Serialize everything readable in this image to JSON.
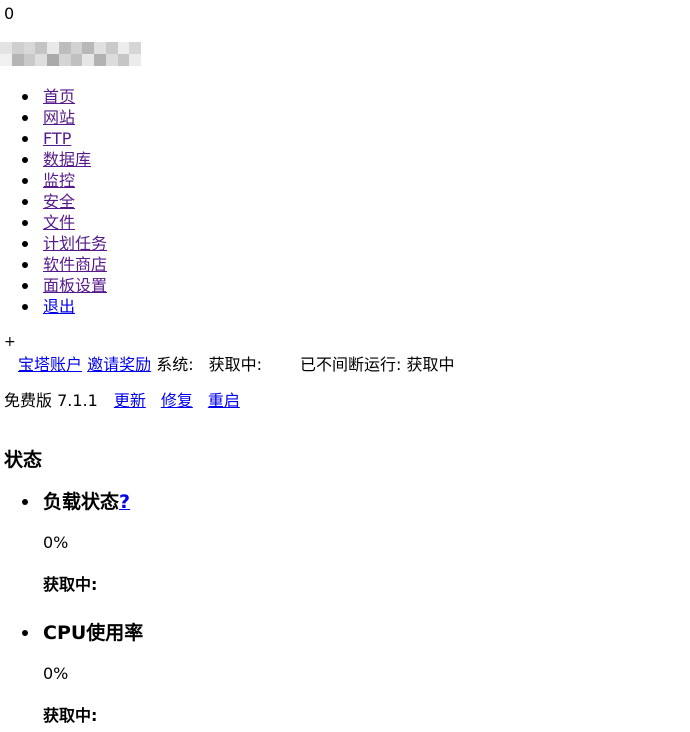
{
  "counter": "0",
  "nav": [
    {
      "label": "首页",
      "visited": true
    },
    {
      "label": "网站",
      "visited": true
    },
    {
      "label": "FTP",
      "visited": true
    },
    {
      "label": "数据库",
      "visited": true
    },
    {
      "label": "监控",
      "visited": true
    },
    {
      "label": "安全",
      "visited": true
    },
    {
      "label": "文件",
      "visited": true
    },
    {
      "label": "计划任务",
      "visited": true
    },
    {
      "label": "软件商店",
      "visited": true
    },
    {
      "label": "面板设置",
      "visited": true
    },
    {
      "label": "退出",
      "visited": false
    }
  ],
  "plus": "+",
  "topbar": {
    "account": "宝塔账户",
    "invite": "邀请奖励",
    "system_label": "系统:",
    "system_value": "获取中:",
    "uptime_label": "已不间断运行:",
    "uptime_value": "获取中"
  },
  "version": {
    "label": "免费版 7.1.1",
    "update": "更新",
    "repair": "修复",
    "restart": "重启"
  },
  "status": {
    "title": "状态",
    "items": [
      {
        "title": "负载状态",
        "help": "?",
        "value": "0%",
        "info": "获取中:"
      },
      {
        "title": "CPU使用率",
        "help": "",
        "value": "0%",
        "info": "获取中:"
      }
    ]
  },
  "colors": {
    "link": "#0000ee",
    "visited": "#551a8b"
  }
}
